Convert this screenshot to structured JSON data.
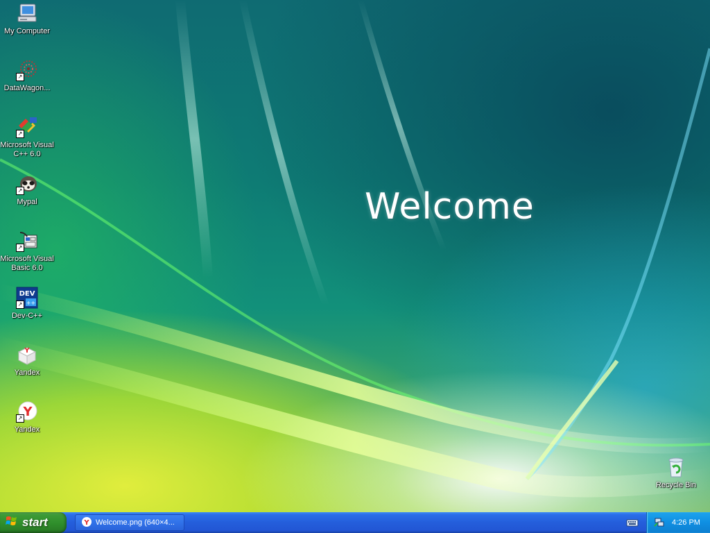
{
  "wallpaper": {
    "title": "Welcome"
  },
  "desktop_icons": [
    {
      "label": "My Computer",
      "icon": "my-computer-icon"
    },
    {
      "label": "DataWagon...",
      "icon": "datawagon-icon"
    },
    {
      "label": "Microsoft Visual C++ 6.0",
      "icon": "visual-cpp-icon"
    },
    {
      "label": "Mypal",
      "icon": "mypal-icon"
    },
    {
      "label": "Microsoft Visual Basic 6.0",
      "icon": "visual-basic-icon"
    },
    {
      "label": "Dev-C++",
      "icon": "dev-cpp-icon"
    },
    {
      "label": "Yandex",
      "icon": "yandex-box-icon"
    },
    {
      "label": "Yandex",
      "icon": "yandex-browser-icon"
    }
  ],
  "recycle_bin": {
    "label": "Recycle Bin",
    "icon": "recycle-bin-icon"
  },
  "taskbar": {
    "start_label": "start",
    "task_items": [
      {
        "label": "Welcome.png (640×4...",
        "icon": "yandex-browser-icon"
      }
    ],
    "tray": {
      "clock": "4:26 PM",
      "icons": [
        "keyboard-icon",
        "network-icon"
      ]
    }
  },
  "colors": {
    "taskbar_blue": "#245edb",
    "start_green": "#2f8e2b",
    "tray_blue": "#0f8fe2"
  }
}
